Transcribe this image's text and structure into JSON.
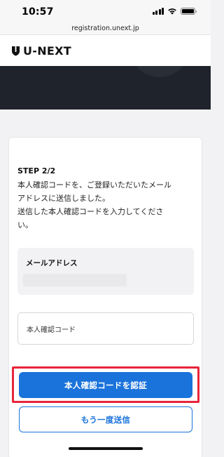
{
  "status_bar": {
    "time": "10:57"
  },
  "browser": {
    "url": "registration.unext.jp"
  },
  "header": {
    "logo_text": "U-NEXT"
  },
  "form": {
    "step_label": "STEP 2/2",
    "description_lines": [
      "本人確認コードを、ご登録いただいたメール",
      "アドレスに送信しました。",
      "送信した本人確認コードを入力してくださ",
      "い。"
    ],
    "email_label": "メールアドレス",
    "code_placeholder": "本人確認コード",
    "verify_button_label": "本人確認コードを認証",
    "resend_button_label": "もう一度送信"
  },
  "colors": {
    "primary": "#1a73db",
    "highlight": "#e8253a",
    "hero": "#1f232b"
  }
}
